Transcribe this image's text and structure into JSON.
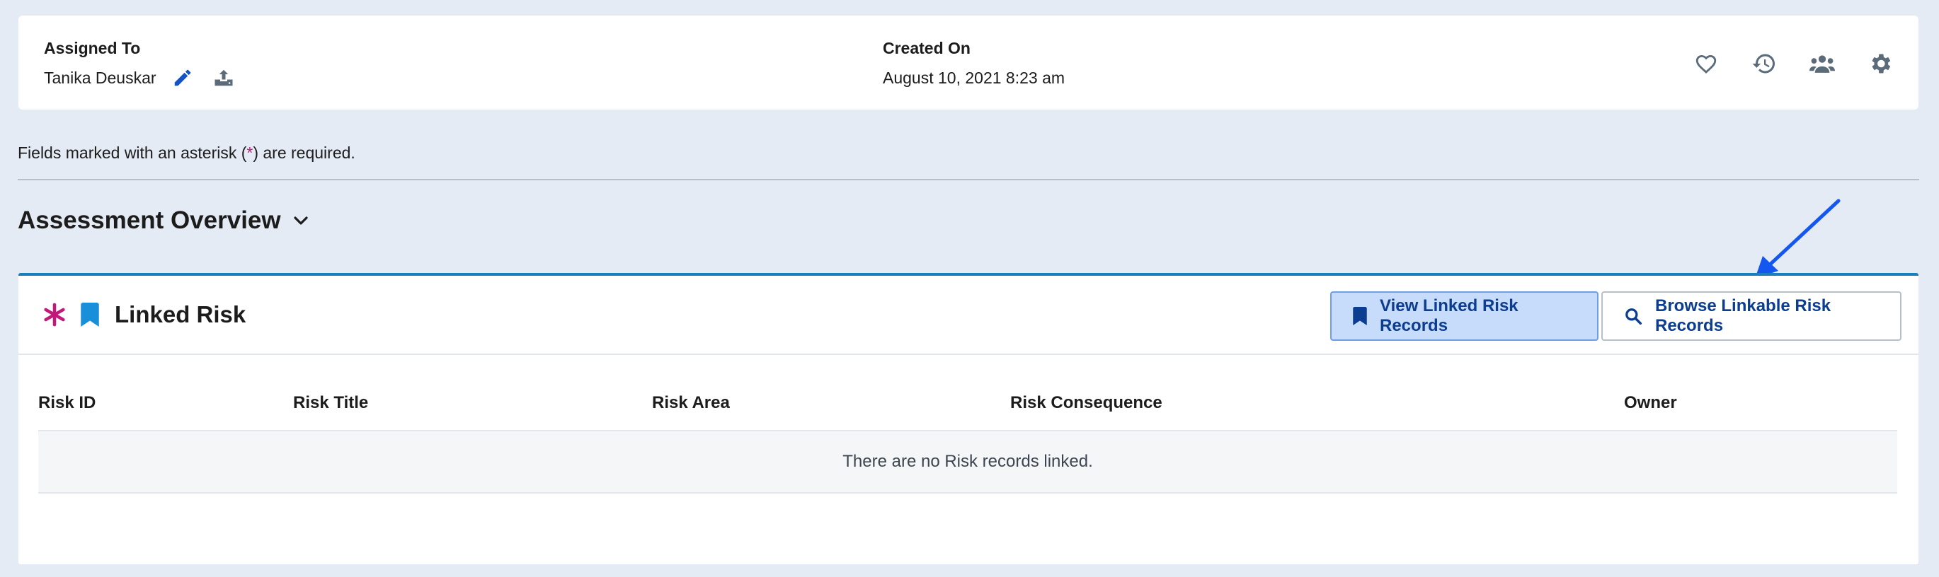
{
  "info": {
    "assigned_label": "Assigned To",
    "assigned_value": "Tanika Deuskar",
    "created_label": "Created On",
    "created_value": "August 10, 2021 8:23 am"
  },
  "required_note": {
    "prefix": "Fields marked with an asterisk (",
    "star": "*",
    "suffix": ") are required."
  },
  "section": {
    "title": "Assessment Overview"
  },
  "linked_risk": {
    "title": "Linked Risk",
    "view_button": "View Linked Risk Records",
    "browse_button": "Browse Linkable Risk Records",
    "columns": [
      "Risk ID",
      "Risk Title",
      "Risk Area",
      "Risk Consequence",
      "Owner"
    ],
    "empty_message": "There are no Risk records linked."
  },
  "colors": {
    "accent_blue": "#1a7fbf",
    "required_magenta": "#c2187a",
    "button_text": "#0b3d91",
    "annotation_arrow": "#1457f0"
  },
  "icons": {
    "edit": "pencil-icon",
    "upload": "upload-icon",
    "favorite": "heart-icon",
    "history": "history-icon",
    "users": "users-icon",
    "settings": "gear-icon",
    "bookmark": "bookmark-icon",
    "search": "search-icon"
  }
}
